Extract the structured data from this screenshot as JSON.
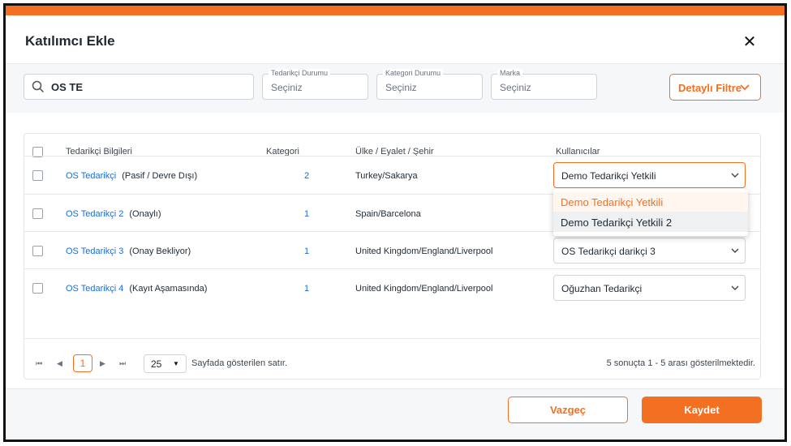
{
  "dialog": {
    "title": "Katılımcı Ekle"
  },
  "search": {
    "value": "OS TE"
  },
  "filters": [
    {
      "label": "Tedarikçi Durumu",
      "placeholder": "Seçiniz"
    },
    {
      "label": "Kategori Durumu",
      "placeholder": "Seçiniz"
    },
    {
      "label": "Marka",
      "placeholder": "Seçiniz"
    }
  ],
  "detail_filter": {
    "label": "Detaylı Filtre"
  },
  "table": {
    "headers": [
      "Tedarikçi Bilgileri",
      "Kategori",
      "Ülke / Eyalet / Şehir",
      "Kullanıcılar"
    ],
    "rows": [
      {
        "name": "OS Tedarikçi",
        "status": "(Pasif / Devre Dışı)",
        "category": "2",
        "location": "Turkey/Sakarya",
        "user": "Demo Tedarikçi Yetkili"
      },
      {
        "name": "OS Tedarikçi 2",
        "status": "(Onaylı)",
        "category": "1",
        "location": "Spain/Barcelona",
        "user": ""
      },
      {
        "name": "OS Tedarikçi 3",
        "status": "(Onay Bekliyor)",
        "category": "1",
        "location": "United Kingdom/England/Liverpool",
        "user": "OS Tedarikçi darikçi 3"
      },
      {
        "name": "OS Tedarikçi 4",
        "status": "(Kayıt Aşamasında)",
        "category": "1",
        "location": "United Kingdom/England/Liverpool",
        "user": "Oğuzhan Tedarikçi"
      }
    ]
  },
  "dropdown": {
    "options": [
      "Demo Tedarikçi Yetkili",
      "Demo Tedarikçi Yetkili 2"
    ],
    "selected_index": 0
  },
  "pagination": {
    "current_page": "1",
    "page_size": "25",
    "page_size_label": "Sayfada gösterilen satır.",
    "summary": "5 sonuçta 1 - 5 arası gösterilmektedir."
  },
  "footer": {
    "cancel": "Vazgeç",
    "save": "Kaydet"
  },
  "colors": {
    "accent": "#f36f21",
    "link": "#1a6dd6"
  }
}
